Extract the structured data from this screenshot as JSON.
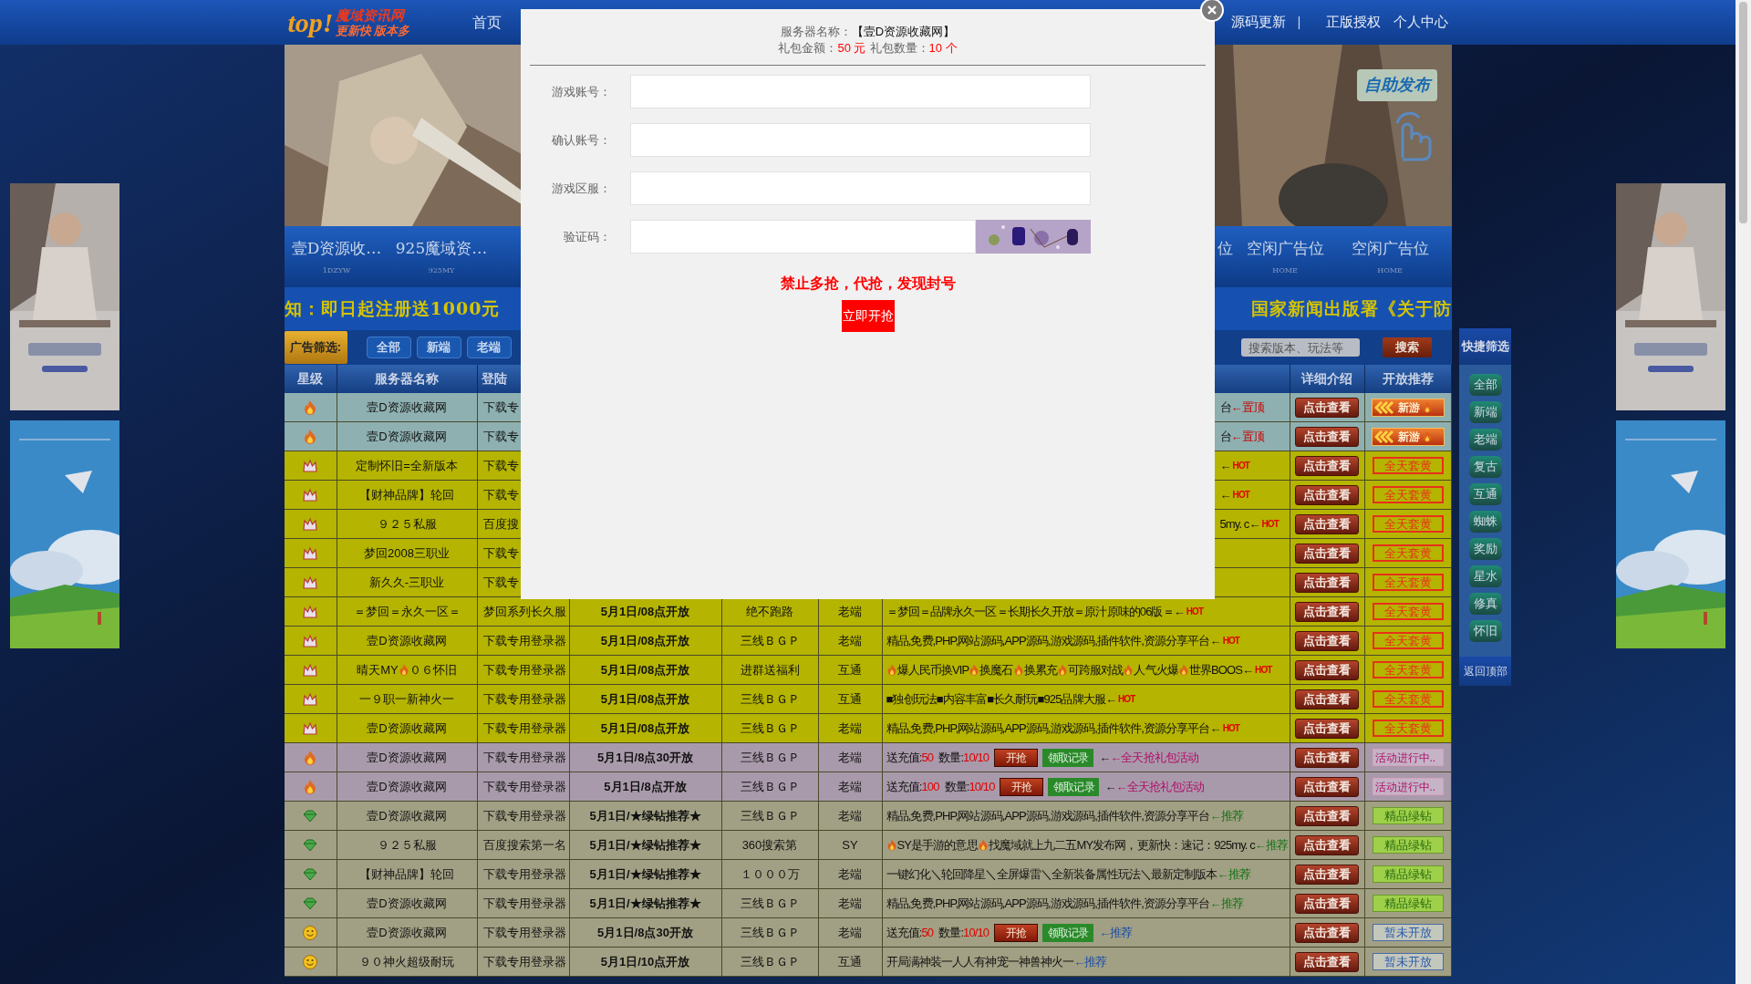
{
  "nav": {
    "logo": {
      "mark": "top!",
      "name": "魔域资讯网",
      "slogan": "更新快 版本多"
    },
    "items_left": [
      "首页"
    ],
    "items_right": [
      {
        "kind": "link",
        "label": "源码更新"
      },
      {
        "kind": "separator",
        "label": "|"
      },
      {
        "kind": "link",
        "label": "正版授权"
      },
      {
        "kind": "link",
        "label": "个人中心"
      }
    ]
  },
  "banner": {
    "publish_button": "自助发布"
  },
  "ad_links_left": [
    {
      "title": "壹D资源收…",
      "subtitle": "1DZYW"
    },
    {
      "title": "925魔域资…",
      "subtitle": "925MY"
    }
  ],
  "ad_link_partial": "位",
  "ad_links_right": [
    {
      "title": "空闲广告位",
      "subtitle": "HOME"
    },
    {
      "title": "空闲广告位",
      "subtitle": "HOME"
    }
  ],
  "notice": {
    "left": "知：即日起注册送1000元",
    "right": "国家新闻出版署《关于防"
  },
  "filter": {
    "label": "广告筛选:",
    "buttons": [
      "全部",
      "新端",
      "老端"
    ],
    "search": {
      "placeholder": "搜索版本、玩法等"
    },
    "search_button": "搜索"
  },
  "table": {
    "columns_left": [
      "星级",
      "服务器名称",
      "登陆"
    ],
    "columns_right": [
      "详细介绍",
      "开放推荐"
    ],
    "rows": [
      {
        "kind": "pinned",
        "name": [
          "壹D资源收藏网"
        ],
        "login": "下载专",
        "intro": {
          "kind": "text",
          "parts": [
            "台"
          ],
          "tag": {
            "kind": "pin",
            "text": "←置顶"
          }
        },
        "view": "点击查看",
        "badge": {
          "kind": "new",
          "text": "新游"
        }
      },
      {
        "kind": "pinned",
        "name": [
          "壹D资源收藏网"
        ],
        "login": "下载专",
        "intro": {
          "kind": "text",
          "parts": [
            "台"
          ],
          "tag": {
            "kind": "pin",
            "text": "←置顶"
          }
        },
        "view": "点击查看",
        "badge": {
          "kind": "new",
          "text": "新游"
        }
      },
      {
        "kind": "yellow",
        "name": [
          "定制怀旧=全新版本"
        ],
        "login": "下载专",
        "intro": {
          "kind": "text",
          "parts": [
            "←"
          ],
          "tag": {
            "kind": "hot",
            "text": "HOT"
          }
        },
        "view": "点击查看",
        "badge": {
          "kind": "yellow",
          "text": "全天套黄"
        }
      },
      {
        "kind": "yellow",
        "name": [
          "【财神品牌】轮回"
        ],
        "login": "下载专",
        "intro": {
          "kind": "text",
          "parts": [
            "←"
          ],
          "tag": {
            "kind": "hot",
            "text": "HOT"
          }
        },
        "view": "点击查看",
        "badge": {
          "kind": "yellow",
          "text": "全天套黄"
        }
      },
      {
        "kind": "yellow",
        "name": [
          "９２５私服"
        ],
        "login": "百度搜",
        "intro": {
          "kind": "text",
          "parts": [
            "5my. c←"
          ],
          "tag": {
            "kind": "hot",
            "text": "HOT"
          }
        },
        "view": "点击查看",
        "badge": {
          "kind": "yellow",
          "text": "全天套黄"
        }
      },
      {
        "kind": "yellow",
        "name": [
          "梦回2008三职业"
        ],
        "login": "下载专",
        "view": "点击查看",
        "badge": {
          "kind": "yellow",
          "text": "全天套黄"
        }
      },
      {
        "kind": "yellow",
        "name": [
          "新久久-三职业"
        ],
        "login": "下载专",
        "view": "点击查看",
        "badge": {
          "kind": "yellow",
          "text": "全天套黄"
        }
      },
      {
        "kind": "yellow",
        "name": [
          "＝梦回＝永久一区＝"
        ],
        "login": "梦回系列长久服",
        "time": "5月1日/08点开放",
        "line": "绝不跑路",
        "type": "老端",
        "intro": {
          "kind": "text",
          "parts": [
            "＝梦回＝品牌永久一区＝长期长久开放＝原汁原味的06版＝←"
          ],
          "tag": {
            "kind": "hot",
            "text": "HOT"
          }
        },
        "view": "点击查看",
        "badge": {
          "kind": "yellow",
          "text": "全天套黄"
        }
      },
      {
        "kind": "yellow",
        "name": [
          "壹D资源收藏网"
        ],
        "login": "下载专用登录器",
        "time": "5月1日/08点开放",
        "line": "三线ＢＧＰ",
        "type": "老端",
        "intro": {
          "kind": "text",
          "parts": [
            "精品,免费,PHP,网站源码,APP源码,游戏源码,插件软件,资源分享平台←"
          ],
          "tag": {
            "kind": "hot",
            "text": "HOT"
          }
        },
        "view": "点击查看",
        "badge": {
          "kind": "yellow",
          "text": "全天套黄"
        }
      },
      {
        "kind": "yellow",
        "name": [
          "晴天MY",
          {
            "kind": "fire"
          },
          "０６怀旧"
        ],
        "login": "下载专用登录器",
        "time": "5月1日/08点开放",
        "line": "进群送福利",
        "type": "互通",
        "intro": {
          "kind": "text",
          "parts": [
            {
              "kind": "fire"
            },
            "爆人民币换VIP",
            {
              "kind": "fire"
            },
            "换魔石",
            {
              "kind": "fire"
            },
            "换累充",
            {
              "kind": "fire"
            },
            "可跨服对战",
            {
              "kind": "fire"
            },
            "人气火爆",
            {
              "kind": "fire"
            },
            "世界BOOS←"
          ],
          "tag": {
            "kind": "hot",
            "text": "HOT"
          }
        },
        "view": "点击查看",
        "badge": {
          "kind": "yellow",
          "text": "全天套黄"
        }
      },
      {
        "kind": "yellow",
        "name": [
          "一９职一新神火一"
        ],
        "login": "下载专用登录器",
        "time": "5月1日/08点开放",
        "line": "三线ＢＧＰ",
        "type": "互通",
        "intro": {
          "kind": "text",
          "parts": [
            "■独创玩法■内容丰富■长久耐玩■925品牌大服←"
          ],
          "tag": {
            "kind": "hot",
            "text": "HOT"
          }
        },
        "view": "点击查看",
        "badge": {
          "kind": "yellow",
          "text": "全天套黄"
        }
      },
      {
        "kind": "yellow",
        "name": [
          "壹D资源收藏网"
        ],
        "login": "下载专用登录器",
        "time": "5月1日/08点开放",
        "line": "三线ＢＧＰ",
        "type": "老端",
        "intro": {
          "kind": "text",
          "parts": [
            "精品,免费,PHP,网站源码,APP源码,游戏源码,插件软件,资源分享平台←"
          ],
          "tag": {
            "kind": "hot",
            "text": "HOT"
          }
        },
        "view": "点击查看",
        "badge": {
          "kind": "yellow",
          "text": "全天套黄"
        }
      },
      {
        "kind": "event",
        "name": [
          "壹D资源收藏网"
        ],
        "login": "下载专用登录器",
        "time": "5月1日/8点30开放",
        "line": "三线ＢＧＰ",
        "type": "老端",
        "intro": {
          "kind": "gift",
          "amount_label": "送充值:",
          "amount": "50",
          "count_label": "数量:",
          "count": "10/10",
          "grab_button": "开抢",
          "record_button": "领取记录",
          "arrow": "←",
          "note": {
            "kind": "event",
            "text": "←全天抢礼包活动"
          }
        },
        "view": "点击查看",
        "badge": {
          "kind": "event",
          "text": "活动进行中.."
        }
      },
      {
        "kind": "event",
        "name": [
          "壹D资源收藏网"
        ],
        "login": "下载专用登录器",
        "time": "5月1日/8点开放",
        "line": "三线ＢＧＰ",
        "type": "老端",
        "intro": {
          "kind": "gift",
          "amount_label": "送充值:",
          "amount": "100",
          "count_label": "数量:",
          "count": "10/10",
          "grab_button": "开抢",
          "record_button": "领取记录",
          "arrow": "←",
          "note": {
            "kind": "event",
            "text": "←全天抢礼包活动"
          }
        },
        "view": "点击查看",
        "badge": {
          "kind": "event",
          "text": "活动进行中.."
        }
      },
      {
        "kind": "diamond",
        "name": [
          "壹D资源收藏网"
        ],
        "login": "下载专用登录器",
        "time": "5月1日/★绿钻推荐★",
        "line": "三线ＢＧＰ",
        "type": "老端",
        "intro": {
          "kind": "text",
          "parts": [
            "精品,免费,PHP,网站源码,APP源码,游戏源码,插件软件,资源分享平台"
          ],
          "tag": {
            "kind": "rec",
            "text": "←推荐"
          }
        },
        "view": "点击查看",
        "badge": {
          "kind": "green",
          "text": "精品绿钻"
        }
      },
      {
        "kind": "diamond",
        "name": [
          "９２５私服"
        ],
        "login": "百度搜索第一名",
        "time": "5月1日/★绿钻推荐★",
        "line": "360搜索第",
        "type": "SY",
        "intro": {
          "kind": "text",
          "parts": [
            {
              "kind": "fire"
            },
            "SY是手游的意思",
            {
              "kind": "fire"
            },
            "找魔域就上九二五MY发布网，更新快：速记：925my. c"
          ],
          "tag": {
            "kind": "rec",
            "text": "←推荐"
          }
        },
        "view": "点击查看",
        "badge": {
          "kind": "green",
          "text": "精品绿钻"
        }
      },
      {
        "kind": "diamond",
        "name": [
          "【财神品牌】轮回"
        ],
        "login": "下载专用登录器",
        "time": "5月1日/★绿钻推荐★",
        "line": "１０００万",
        "type": "老端",
        "intro": {
          "kind": "text",
          "parts": [
            "一键幻化＼轮回降星＼全屏爆雷＼全新装备属性玩法＼最新定制版本"
          ],
          "tag": {
            "kind": "rec",
            "text": "←推荐"
          }
        },
        "view": "点击查看",
        "badge": {
          "kind": "green",
          "text": "精品绿钻"
        }
      },
      {
        "kind": "diamond",
        "name": [
          "壹D资源收藏网"
        ],
        "login": "下载专用登录器",
        "time": "5月1日/★绿钻推荐★",
        "line": "三线ＢＧＰ",
        "type": "老端",
        "intro": {
          "kind": "text",
          "parts": [
            "精品,免费,PHP,网站源码,APP源码,游戏源码,插件软件,资源分享平台"
          ],
          "tag": {
            "kind": "rec",
            "text": "←推荐"
          }
        },
        "view": "点击查看",
        "badge": {
          "kind": "green",
          "text": "精品绿钻"
        }
      },
      {
        "kind": "basic",
        "name": [
          "壹D资源收藏网"
        ],
        "login": "下载专用登录器",
        "time": "5月1日/8点30开放",
        "line": "三线ＢＧＰ",
        "type": "老端",
        "intro": {
          "kind": "gift",
          "amount_label": "送充值:",
          "amount": "50",
          "count_label": "数量:",
          "count": "10/10",
          "grab_button": "开抢",
          "record_button": "领取记录",
          "note": {
            "kind": "rec-blue",
            "text": "←推荐"
          }
        },
        "view": "点击查看",
        "badge": {
          "kind": "pending",
          "text": "暂未开放"
        }
      },
      {
        "kind": "basic",
        "name": [
          "９０神火超级耐玩"
        ],
        "login": "下载专用登录器",
        "time": "5月1日/10点开放",
        "line": "三线ＢＧＰ",
        "type": "互通",
        "intro": {
          "kind": "text",
          "parts": [
            "开局满神装一人人有神宠一神兽神火一"
          ],
          "tag": {
            "kind": "rec-blue",
            "text": "←推荐"
          }
        },
        "view": "点击查看",
        "badge": {
          "kind": "pending",
          "text": "暂未开放"
        }
      }
    ]
  },
  "quick_filter": {
    "title": "快捷筛选",
    "buttons": [
      "全部",
      "新端",
      "老端",
      "复古",
      "互通",
      "蜘蛛",
      "奖励",
      "星水",
      "修真",
      "怀旧"
    ],
    "back_to_top": "返回顶部"
  },
  "modal": {
    "server_label": "服务器名称：",
    "server_name": "【壹D资源收藏网】",
    "amount_label": "礼包金额：",
    "amount": "50 元",
    "count_label": "礼包数量：",
    "count": "10 个",
    "fields": [
      {
        "label": "游戏账号：",
        "kind": "text"
      },
      {
        "label": "确认账号：",
        "kind": "text"
      },
      {
        "label": "游戏区服：",
        "kind": "text"
      },
      {
        "label": "验证码：",
        "kind": "captcha"
      }
    ],
    "warning": "禁止多抢，代抢，发现封号",
    "submit": "立即开抢"
  }
}
